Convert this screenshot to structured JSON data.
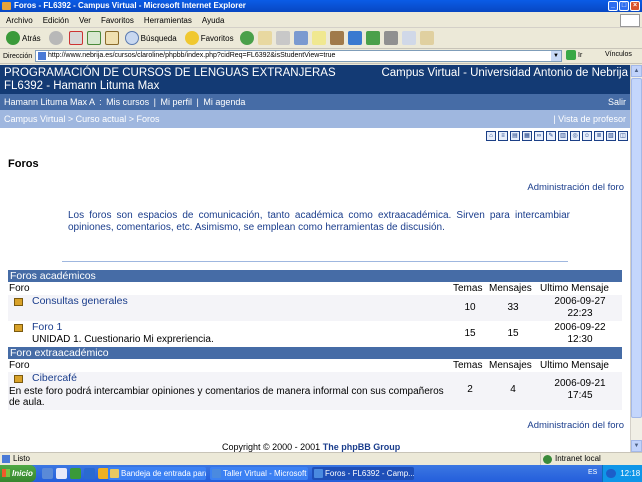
{
  "window": {
    "title": "Foros - FL6392 - Campus Virtual - Microsoft Internet Explorer"
  },
  "menu": [
    "Archivo",
    "Edición",
    "Ver",
    "Favoritos",
    "Herramientas",
    "Ayuda"
  ],
  "toolbar": {
    "back_label": "Atrás",
    "search_label": "Búsqueda",
    "favorites_label": "Favoritos"
  },
  "address": {
    "label": "Dirección",
    "url": "http://www.nebrija.es/cursos/claroline/phpbb/index.php?cidReq=FL6392&isStudentView=true",
    "go_label": "Ir",
    "links_label": "Vínculos"
  },
  "banner": {
    "line1": "PROGRAMACIÓN DE CURSOS DE LENGUAS EXTRANJERAS",
    "line2": "FL6392 - Hamann Lituma Max",
    "right": "Campus Virtual - Universidad Antonio de Nebrija"
  },
  "userbar": {
    "user": "Hamann Lituma Max A",
    "links": [
      "Mis cursos",
      "Mi perfil",
      "Mi agenda"
    ],
    "logout": "Salir"
  },
  "breadcrumb": {
    "items": [
      "Campus Virtual",
      "Curso actual",
      "Foros"
    ],
    "separator": ">",
    "view": "Vista de profesor"
  },
  "page": {
    "heading": "Foros",
    "admin_link": "Administración del foro",
    "intro": "Los foros son espacios de comunicación, tanto académica como extraacadémica. Sirven para intercambiar opiniones, comentarios, etc. Asimismo, se emplean como herramientas de discusión.",
    "columns": {
      "forum": "Foro",
      "topics": "Temas",
      "posts": "Mensajes",
      "last": "Ultimo Mensaje"
    },
    "sections": [
      {
        "title": "Foros académicos",
        "forums": [
          {
            "name": "Consultas generales",
            "description": "",
            "topics": "10",
            "posts": "33",
            "last_date": "2006-09-27",
            "last_time": "22:23"
          },
          {
            "name": "Foro 1",
            "description": "UNIDAD 1. Cuestionario Mi exprerienciа.",
            "topics": "15",
            "posts": "15",
            "last_date": "2006-09-22",
            "last_time": "12:30"
          }
        ]
      },
      {
        "title": "Foro extraacadémico",
        "forums": [
          {
            "name": "Cibercafé",
            "description": "En este foro podrá intercambiar opiniones y comentarios de manera informal con sus compañeros de aula.",
            "topics": "2",
            "posts": "4",
            "last_date": "2006-09-21",
            "last_time": "17:45"
          }
        ]
      }
    ],
    "copyright": "Copyright © 2000 - 2001",
    "copyright_link": "The phpBB Group"
  },
  "statusbar": {
    "text": "Listo",
    "zone": "Intranet local"
  },
  "taskbar": {
    "start": "Inicio",
    "tasks": [
      "Bandeja de entrada para ...",
      "Taller Virtual - Microsoft ...",
      "Foros - FL6392 - Camp..."
    ],
    "lang": "ES",
    "clock": "12:18"
  }
}
